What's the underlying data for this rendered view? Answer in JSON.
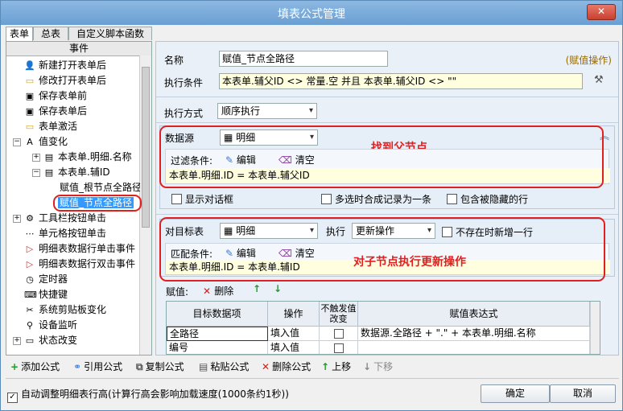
{
  "window": {
    "title": "填表公式管理",
    "close_label": "✕"
  },
  "tabs": [
    {
      "label": "表单"
    },
    {
      "label": "总表"
    },
    {
      "label": "自定义脚本函数"
    }
  ],
  "events": {
    "header": "事件",
    "items": [
      {
        "label": "新建打开表单后"
      },
      {
        "label": "修改打开表单后"
      },
      {
        "label": "保存表单前"
      },
      {
        "label": "保存表单后"
      },
      {
        "label": "表单激活"
      },
      {
        "label": "值变化"
      },
      {
        "label": "本表单.明细.名称"
      },
      {
        "label": "本表单.辅ID"
      },
      {
        "label": "赋值_根节点全路径"
      },
      {
        "label": "赋值_节点全路径"
      },
      {
        "label": "工具栏按钮单击"
      },
      {
        "label": "单元格按钮单击"
      },
      {
        "label": "明细表数据行单击事件"
      },
      {
        "label": "明细表数据行双击事件"
      },
      {
        "label": "定时器"
      },
      {
        "label": "快捷键"
      },
      {
        "label": "系统剪贴板变化"
      },
      {
        "label": "设备监听"
      },
      {
        "label": "状态改变"
      }
    ]
  },
  "form": {
    "name_label": "名称",
    "name_value": "赋值_节点全路径",
    "op_tag": "(赋值操作)",
    "cond_label": "执行条件",
    "cond_value": "本表单.辅父ID <> 常量.空 并且 本表单.辅父ID <> \"\"",
    "mode_label": "执行方式",
    "mode_value": "顺序执行"
  },
  "source": {
    "label": "数据源",
    "value": "明细",
    "filter_label": "过滤条件:",
    "edit_label": "编辑",
    "clear_label": "清空",
    "filter_expr": "本表单.明细.ID = 本表单.辅父ID",
    "show_dialog": "显示对话框",
    "merge_multi": "多选时合成记录为一条",
    "include_hidden": "包含被隐藏的行",
    "annotation": "找到父节点"
  },
  "target": {
    "label": "对目标表",
    "value": "明细",
    "exec_label": "执行",
    "exec_value": "更新操作",
    "add_if_missing": "不存在时新增一行",
    "match_label": "匹配条件:",
    "edit_label": "编辑",
    "clear_label": "清空",
    "match_expr": "本表单.明细.ID = 本表单.辅ID",
    "annotation": "对子节点执行更新操作"
  },
  "assign": {
    "label": "赋值:",
    "delete_label": "删除",
    "columns": [
      "目标数据项",
      "操作",
      "不触发值改变",
      "赋值表达式"
    ],
    "rows": [
      {
        "target": "全路径",
        "op": "填入值",
        "expr": "数据源.全路径 + \".\" + 本表单.明细.名称"
      },
      {
        "target": "编号",
        "op": "填入值",
        "expr": ""
      }
    ]
  },
  "toolbar": {
    "add": "添加公式",
    "ref": "引用公式",
    "copy": "复制公式",
    "paste": "粘贴公式",
    "delete": "删除公式",
    "up": "上移",
    "down": "下移"
  },
  "footer": {
    "auto_height": "自动调整明细表行高(计算行高会影响加载速度(1000条约1秒))",
    "ok": "确定",
    "cancel": "取消"
  },
  "colors": {
    "accent_red": "#e02020",
    "title_blue": "#7aaedb",
    "selection": "#3399ff"
  }
}
